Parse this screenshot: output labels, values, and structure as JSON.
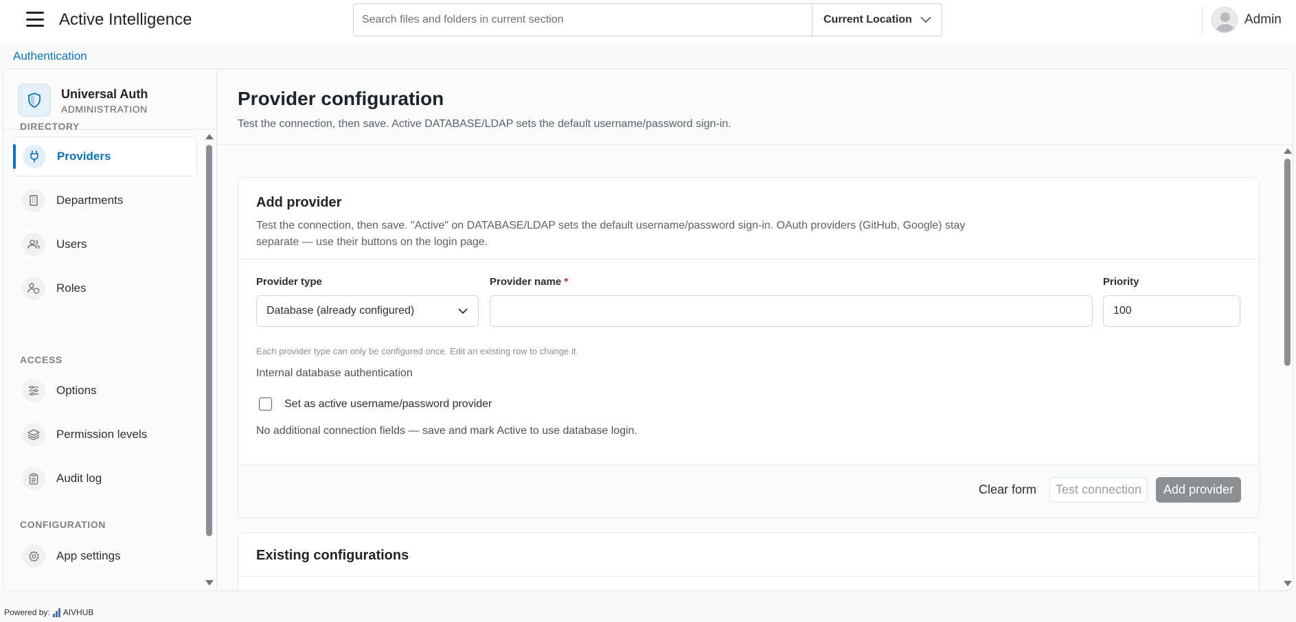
{
  "header": {
    "app_title": "Active Intelligence",
    "search_placeholder": "Search files and folders in current section",
    "location_label": "Current Location",
    "user_name": "Admin"
  },
  "breadcrumb": "Authentication",
  "sidebar": {
    "title": "Universal Auth",
    "subtitle": "ADMINISTRATION",
    "sections": {
      "directory": "DIRECTORY",
      "access": "ACCESS",
      "configuration": "CONFIGURATION"
    },
    "items": [
      {
        "label": "Providers",
        "icon": "plug-icon",
        "active": true
      },
      {
        "label": "Departments",
        "icon": "building-icon"
      },
      {
        "label": "Users",
        "icon": "users-icon"
      },
      {
        "label": "Roles",
        "icon": "user-shield-icon"
      },
      {
        "label": "Options",
        "icon": "sliders-icon"
      },
      {
        "label": "Permission levels",
        "icon": "layers-icon"
      },
      {
        "label": "Audit log",
        "icon": "clipboard-icon"
      },
      {
        "label": "App settings",
        "icon": "gear-icon"
      }
    ]
  },
  "page": {
    "title": "Provider configuration",
    "description": "Test the connection, then save. Active DATABASE/LDAP sets the default username/password sign-in."
  },
  "add_provider": {
    "title": "Add provider",
    "description": "Test the connection, then save. \"Active\" on DATABASE/LDAP sets the default username/password sign-in. OAuth providers (GitHub, Google) stay separate — use their buttons on the login page.",
    "provider_type_label": "Provider type",
    "provider_type_value": "Database (already configured)",
    "provider_name_label": "Provider name",
    "required_mark": "*",
    "provider_name_value": "",
    "priority_label": "Priority",
    "priority_value": "100",
    "hint": "Each provider type can only be configured once. Edit an existing row to change it.",
    "type_description": "Internal database authentication",
    "active_checkbox_label": "Set as active username/password provider",
    "active_checked": false,
    "no_fields_note": "No additional connection fields — save and mark Active to use database login.",
    "clear_label": "Clear form",
    "test_label": "Test connection",
    "add_label": "Add provider"
  },
  "existing": {
    "title": "Existing configurations"
  },
  "footer": {
    "powered_by": "Powered by:",
    "brand": "AIVHUB"
  },
  "colors": {
    "accent": "#0b72b5",
    "disabled_button": "#8b8f94"
  }
}
